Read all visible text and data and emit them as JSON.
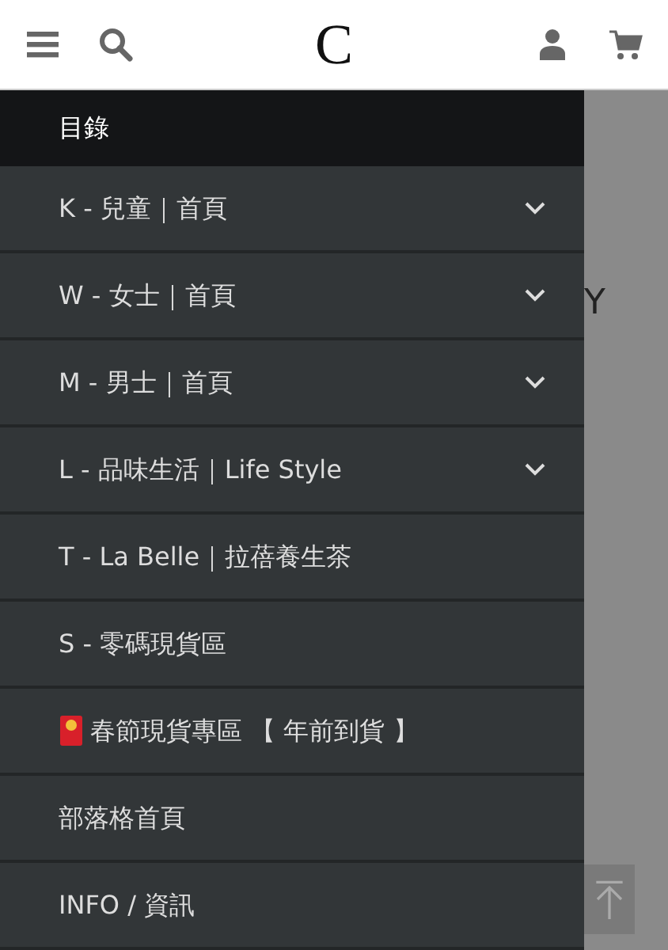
{
  "header": {
    "logo": "C"
  },
  "drawer": {
    "title": "目錄",
    "items": [
      {
        "label": "K - 兒童｜首頁",
        "expandable": true
      },
      {
        "label": "W - 女士｜首頁",
        "expandable": true
      },
      {
        "label": "M - 男士｜首頁",
        "expandable": true
      },
      {
        "label": "L - 品味生活｜Life Style",
        "expandable": true
      },
      {
        "label": "T - La Belle｜拉蓓養生茶",
        "expandable": false
      },
      {
        "label": "S - 零碼現貨區",
        "expandable": false
      },
      {
        "label": "春節現貨專區 【 年前到貨 】",
        "expandable": false,
        "kind": "envelope"
      },
      {
        "label": "部落格首頁",
        "expandable": false
      },
      {
        "label": "INFO / 資訊",
        "expandable": false
      }
    ]
  },
  "backdrop": {
    "text": "Y"
  }
}
